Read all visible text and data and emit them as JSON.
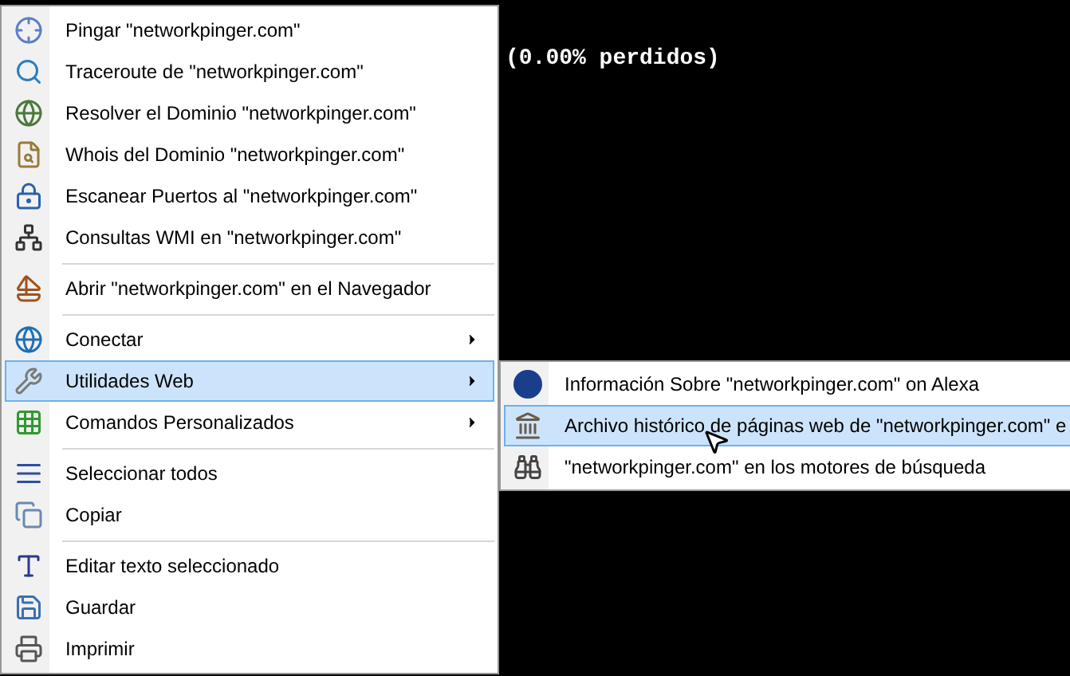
{
  "terminal": {
    "text": "(0.00% perdidos)"
  },
  "context_menu": {
    "groups": [
      [
        {
          "label": "Pingar \"networkpinger.com\"",
          "selected": false,
          "submenu": false
        },
        {
          "label": "Traceroute de \"networkpinger.com\"",
          "selected": false,
          "submenu": false
        },
        {
          "label": "Resolver el Dominio \"networkpinger.com\"",
          "selected": false,
          "submenu": false
        },
        {
          "label": "Whois del Dominio \"networkpinger.com\"",
          "selected": false,
          "submenu": false
        },
        {
          "label": "Escanear Puertos al \"networkpinger.com\"",
          "selected": false,
          "submenu": false
        },
        {
          "label": "Consultas WMI en \"networkpinger.com\"",
          "selected": false,
          "submenu": false
        }
      ],
      [
        {
          "label": "Abrir \"networkpinger.com\" en el Navegador",
          "selected": false,
          "submenu": false
        }
      ],
      [
        {
          "label": "Conectar",
          "selected": false,
          "submenu": true
        },
        {
          "label": "Utilidades Web",
          "selected": true,
          "submenu": true
        },
        {
          "label": "Comandos Personalizados",
          "selected": false,
          "submenu": true
        }
      ],
      [
        {
          "label": "Seleccionar todos",
          "selected": false,
          "submenu": false
        },
        {
          "label": "Copiar",
          "selected": false,
          "submenu": false
        }
      ],
      [
        {
          "label": "Editar texto seleccionado",
          "selected": false,
          "submenu": false
        },
        {
          "label": "Guardar",
          "selected": false,
          "submenu": false
        },
        {
          "label": "Imprimir",
          "selected": false,
          "submenu": false
        }
      ]
    ]
  },
  "submenu": {
    "items": [
      {
        "label": "Información Sobre \"networkpinger.com\" on Alexa",
        "selected": false
      },
      {
        "label": "Archivo histórico de páginas web de \"networkpinger.com\" e",
        "selected": true
      },
      {
        "label": "\"networkpinger.com\" en los motores de búsqueda",
        "selected": false
      }
    ]
  }
}
